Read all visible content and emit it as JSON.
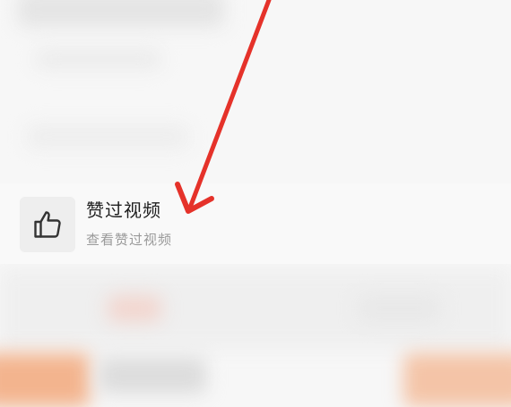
{
  "menu_item": {
    "title": "赞过视频",
    "subtitle": "查看赞过视频",
    "icon": "thumbs-up-icon"
  },
  "annotation": {
    "color": "#e5322a"
  }
}
